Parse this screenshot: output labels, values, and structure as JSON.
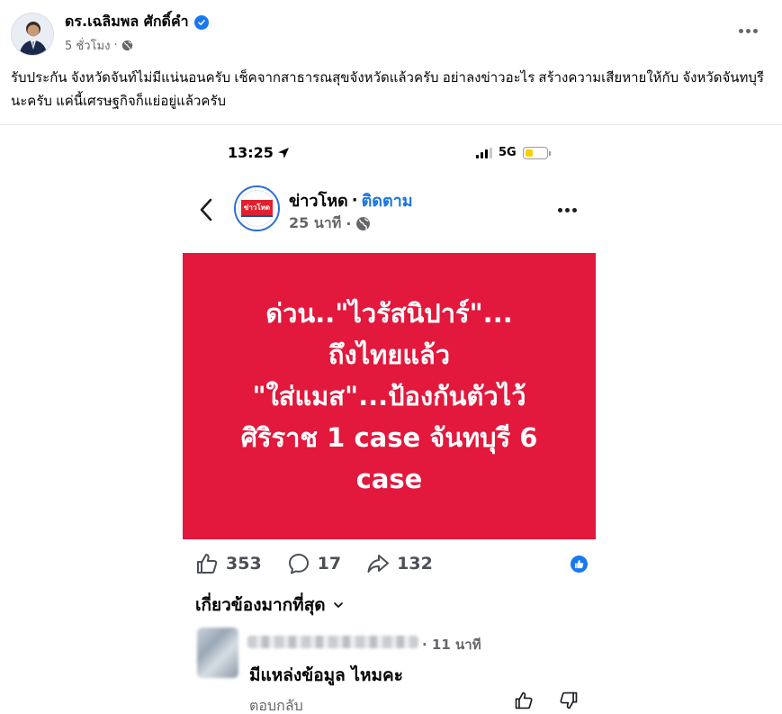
{
  "post": {
    "author": "ดร.เฉลิมพล ศักดิ์คำ",
    "time": "5 ชั่วโมง",
    "separator": "·",
    "caption": "รับประกัน  จังหวัดจันท์ไม่มีแน่นอนครับ  เช็คจากสาธารณสุขจังหวัดแล้วครับ อย่าลงข่าวอะไร  สร้างความเสียหายให้กับ จังหวัดจันทบุรีนะครับ  แค่นี้เศรษฐกิจก็แย่อยู่แล้วครับ"
  },
  "screenshot": {
    "status_bar": {
      "time": "13:25",
      "network": "5G",
      "battery_level": 0.4
    },
    "page": {
      "logo_text": "ข่าวโหด",
      "name": "ข่าวโหด",
      "separator": "·",
      "follow": "ติดตาม",
      "time": "25 นาที",
      "time_separator": "·"
    },
    "headline": {
      "lines": [
        "ด่วน..\"ไวรัสนิปาร์\"...",
        "ถึงไทยแล้ว",
        "\"ใส่แมส\"...ป้องกันตัวไว้",
        "ศิริราช 1 case จันทบุรี 6",
        "case"
      ]
    },
    "reactions": {
      "likes": "353",
      "comments": "17",
      "shares": "132"
    },
    "sort_label": "เกี่ยวข้องมากที่สุด",
    "comment": {
      "time": "· 11 นาที",
      "text": "มีแหล่งข้อมูล ไหมคะ",
      "reply": "ตอบกลับ"
    },
    "colors": {
      "card_red": "#e2183c",
      "link_blue": "#1b74e4",
      "fb_blue": "#1877f2"
    }
  }
}
